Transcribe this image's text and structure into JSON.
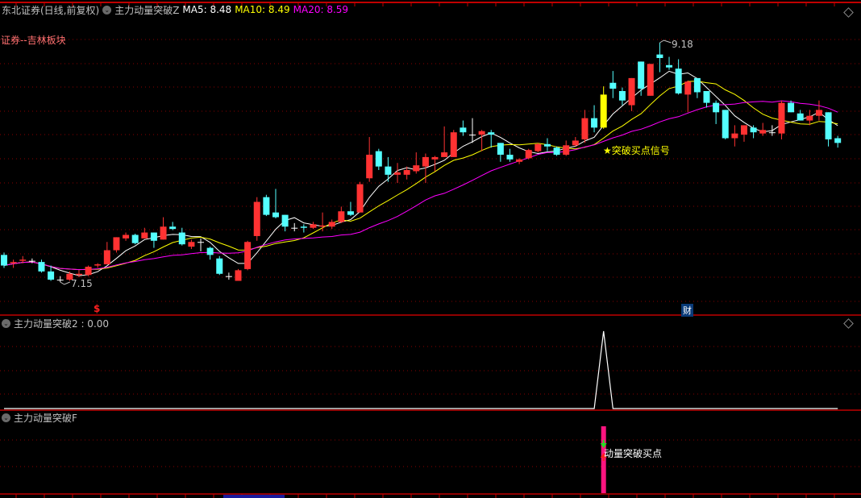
{
  "header": {
    "stock": "东北证券(日线,前复权)",
    "indicator": "主力动量突破Z",
    "ma5": "MA5: 8.48",
    "ma10": "MA10: 8.49",
    "ma20": "MA20: 8.59",
    "sector": "证券--吉林板块"
  },
  "annotations": {
    "high_label": "9.18",
    "low_label": "7.15",
    "signal_text": "★突破买点信号",
    "dollar_marker": "$",
    "finance_marker": "财"
  },
  "panel2": {
    "title": "主力动量突破2 : 0.00"
  },
  "panel3": {
    "title": "主力动量突破F",
    "signal_text": "动量突破买点"
  },
  "colors": {
    "up": "#ff3232",
    "down": "#54ffff",
    "signal": "#ffff00",
    "ma5": "#ffffff",
    "ma10": "#ffff00",
    "ma20": "#ff00ff",
    "grid": "#8a0000",
    "bar": "#ff1480"
  },
  "chart_data": {
    "type": "candlestick",
    "price_range": [
      7.15,
      9.18
    ],
    "signal_index": 64,
    "ohlc": [
      [
        7.38,
        7.29,
        7.4,
        7.27
      ],
      [
        7.31,
        7.32,
        7.34,
        7.27
      ],
      [
        7.33,
        7.34,
        7.37,
        7.31
      ],
      [
        7.33,
        7.33,
        7.35,
        7.31
      ],
      [
        7.32,
        7.24,
        7.34,
        7.23
      ],
      [
        7.24,
        7.17,
        7.29,
        7.16
      ],
      [
        7.17,
        7.17,
        7.2,
        7.15
      ],
      [
        7.17,
        7.22,
        7.24,
        7.16
      ],
      [
        7.21,
        7.22,
        7.25,
        7.19
      ],
      [
        7.21,
        7.28,
        7.29,
        7.2
      ],
      [
        7.29,
        7.3,
        7.31,
        7.27
      ],
      [
        7.3,
        7.42,
        7.49,
        7.3
      ],
      [
        7.42,
        7.53,
        7.53,
        7.4
      ],
      [
        7.52,
        7.55,
        7.57,
        7.5
      ],
      [
        7.55,
        7.48,
        7.56,
        7.47
      ],
      [
        7.52,
        7.57,
        7.61,
        7.52
      ],
      [
        7.57,
        7.5,
        7.57,
        7.44
      ],
      [
        7.51,
        7.62,
        7.7,
        7.51
      ],
      [
        7.62,
        7.6,
        7.66,
        7.59
      ],
      [
        7.57,
        7.47,
        7.61,
        7.46
      ],
      [
        7.45,
        7.49,
        7.51,
        7.43
      ],
      [
        7.49,
        7.49,
        7.52,
        7.41
      ],
      [
        7.44,
        7.38,
        7.45,
        7.34
      ],
      [
        7.35,
        7.22,
        7.37,
        7.21
      ],
      [
        7.2,
        7.2,
        7.23,
        7.17
      ],
      [
        7.16,
        7.25,
        7.26,
        7.16
      ],
      [
        7.26,
        7.49,
        7.5,
        7.25
      ],
      [
        7.54,
        7.83,
        7.87,
        7.5
      ],
      [
        7.87,
        7.72,
        7.89,
        7.71
      ],
      [
        7.74,
        7.7,
        7.94,
        7.69
      ],
      [
        7.72,
        7.62,
        7.72,
        7.58
      ],
      [
        7.61,
        7.61,
        7.65,
        7.58
      ],
      [
        7.62,
        7.61,
        7.64,
        7.57
      ],
      [
        7.61,
        7.64,
        7.66,
        7.6
      ],
      [
        7.62,
        7.63,
        7.74,
        7.58
      ],
      [
        7.62,
        7.66,
        7.68,
        7.6
      ],
      [
        7.66,
        7.75,
        7.79,
        7.65
      ],
      [
        7.75,
        7.72,
        7.83,
        7.71
      ],
      [
        7.74,
        7.98,
        8.0,
        7.74
      ],
      [
        8.03,
        8.23,
        8.38,
        8.0
      ],
      [
        8.26,
        8.13,
        8.28,
        8.1
      ],
      [
        8.13,
        8.06,
        8.21,
        8.0
      ],
      [
        8.06,
        8.08,
        8.16,
        7.99
      ],
      [
        8.06,
        8.1,
        8.13,
        8.02
      ],
      [
        8.09,
        8.14,
        8.25,
        8.07
      ],
      [
        8.13,
        8.21,
        8.24,
        7.99
      ],
      [
        8.19,
        8.21,
        8.22,
        8.09
      ],
      [
        8.21,
        8.25,
        8.47,
        8.21
      ],
      [
        8.21,
        8.42,
        8.44,
        8.21
      ],
      [
        8.46,
        8.42,
        8.52,
        8.39
      ],
      [
        8.4,
        8.4,
        8.54,
        8.33
      ],
      [
        8.4,
        8.43,
        8.44,
        8.26
      ],
      [
        8.42,
        8.4,
        8.44,
        8.29
      ],
      [
        8.33,
        8.23,
        8.33,
        8.17
      ],
      [
        8.23,
        8.19,
        8.28,
        8.17
      ],
      [
        8.17,
        8.19,
        8.2,
        8.15
      ],
      [
        8.2,
        8.27,
        8.28,
        8.19
      ],
      [
        8.26,
        8.32,
        8.33,
        8.25
      ],
      [
        8.32,
        8.3,
        8.37,
        8.26
      ],
      [
        8.29,
        8.23,
        8.3,
        8.22
      ],
      [
        8.23,
        8.31,
        8.35,
        8.22
      ],
      [
        8.31,
        8.35,
        8.38,
        8.3
      ],
      [
        8.36,
        8.54,
        8.61,
        8.33
      ],
      [
        8.54,
        8.46,
        8.65,
        8.42
      ],
      [
        8.46,
        8.74,
        8.81,
        8.45
      ],
      [
        8.84,
        8.79,
        8.94,
        8.71
      ],
      [
        8.77,
        8.69,
        8.8,
        8.65
      ],
      [
        8.65,
        8.88,
        8.88,
        8.6
      ],
      [
        9.02,
        8.79,
        9.02,
        8.73
      ],
      [
        8.73,
        9.0,
        9.0,
        8.73
      ],
      [
        9.08,
        9.05,
        9.18,
        8.93
      ],
      [
        8.99,
        8.97,
        9.06,
        8.95
      ],
      [
        8.96,
        8.75,
        9.04,
        8.74
      ],
      [
        8.74,
        8.85,
        8.86,
        8.59
      ],
      [
        8.88,
        8.76,
        8.88,
        8.71
      ],
      [
        8.77,
        8.67,
        8.77,
        8.63
      ],
      [
        8.67,
        8.59,
        8.69,
        8.49
      ],
      [
        8.61,
        8.37,
        8.61,
        8.36
      ],
      [
        8.37,
        8.41,
        8.48,
        8.3
      ],
      [
        8.4,
        8.48,
        8.48,
        8.34
      ],
      [
        8.46,
        8.42,
        8.48,
        8.37
      ],
      [
        8.41,
        8.44,
        8.5,
        8.39
      ],
      [
        8.42,
        8.42,
        8.48,
        8.39
      ],
      [
        8.41,
        8.67,
        8.69,
        8.36
      ],
      [
        8.67,
        8.59,
        8.69,
        8.59
      ],
      [
        8.58,
        8.52,
        8.61,
        8.52
      ],
      [
        8.52,
        8.56,
        8.61,
        8.48
      ],
      [
        8.56,
        8.61,
        8.69,
        8.52
      ],
      [
        8.59,
        8.36,
        8.59,
        8.3
      ],
      [
        8.37,
        8.33,
        8.39,
        8.29
      ]
    ],
    "ma_periods": [
      5,
      10,
      20
    ],
    "panel2_values_nonzero": {
      "64": 1
    },
    "panel3_signal_index": 64
  }
}
